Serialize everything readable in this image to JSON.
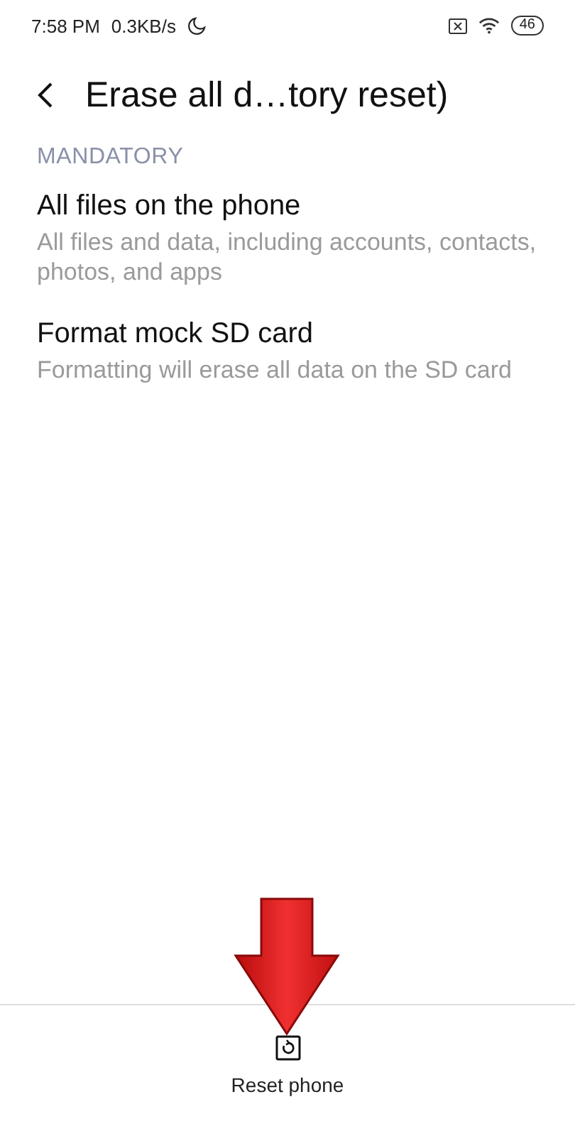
{
  "status_bar": {
    "time": "7:58 PM",
    "speed": "0.3KB/s",
    "battery": "46"
  },
  "header": {
    "title": "Erase all d…tory reset)"
  },
  "section": {
    "title": "MANDATORY",
    "items": [
      {
        "title": "All files on the phone",
        "subtitle": "All files and data, including accounts, contacts, photos, and apps"
      },
      {
        "title": "Format mock SD card",
        "subtitle": "Formatting will erase all data on the SD card"
      }
    ]
  },
  "bottom_action": {
    "label": "Reset phone"
  }
}
